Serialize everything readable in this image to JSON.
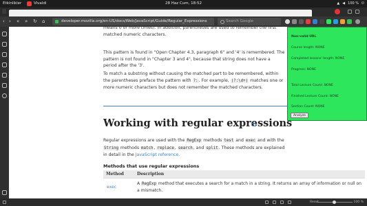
{
  "os": {
    "activities": "Etkinlikler",
    "app_name": "Vivaldi",
    "clock": "28 Haz Cum, 18:52",
    "volume": "100 %"
  },
  "browser": {
    "url": "developer.mozilla.org/en-US/docs/Web/JavaScript/Guide/Regular_Expressions",
    "search_placeholder": "Search Google",
    "zoom_label": "Reset",
    "zoom_value": "100 %"
  },
  "article": {
    "p0": "means 0 or more times). In addition, parentheses are used to remember the first matched numeric characters.",
    "p1": "This pattern is found in \"Open Chapter 4.3, paragraph 6\" and '4' is remembered. The pattern is not found in \"Chapter 3 and 4\", because that string does not have a period after the '3'.",
    "p2_a": "To match a substring without causing the matched part to be remembered, within the parentheses preface the pattern with",
    "p2_code1": "?:",
    "p2_b": ". For example,",
    "p2_code2": "(?:\\d+)",
    "p2_c": "matches one or more numeric characters but does not remember the matched characters.",
    "h2": "Working with regular expressions",
    "p3_a": "Regular expressions are used with the",
    "p3_regexp": "RegExp",
    "p3_b": "methods",
    "p3_test": "test",
    "p3_c": "and",
    "p3_exec": "exec",
    "p3_d": "and with the",
    "p3_string": "String",
    "p3_e": "methods",
    "p3_match": "match",
    "p3_replace": "replace",
    "p3_search": "search",
    "p3_f": ", and",
    "p3_split": "split",
    "p3_g": ". These methods are explained in detail in the",
    "p3_link": "JavaScript reference",
    "h4": "Methods that use regular expressions",
    "table": {
      "col_method": "Method",
      "col_desc": "Description",
      "row1_method": "exec",
      "row1_desc_a": "A",
      "row1_desc_code": "RegExp",
      "row1_desc_b": "method that executes a search for a match in a string. It returns an array of information or null on a mismatch."
    }
  },
  "panel": {
    "title": "Non-valid URL",
    "course_length": "Course length: NONE",
    "completed_length": "Completed lessons' length: NONE",
    "progress": "Progress: NONE",
    "total_count": "Total Lecture Count: NONE",
    "finished_count": "Finished Lecture Count: NONE",
    "section_count": "Section Count: NONE",
    "analyze_button": "Analyze"
  },
  "colors": {
    "panel_bg": "#2ee65b",
    "link": "#3d7fc6",
    "vivaldi_red": "#ef3939"
  }
}
